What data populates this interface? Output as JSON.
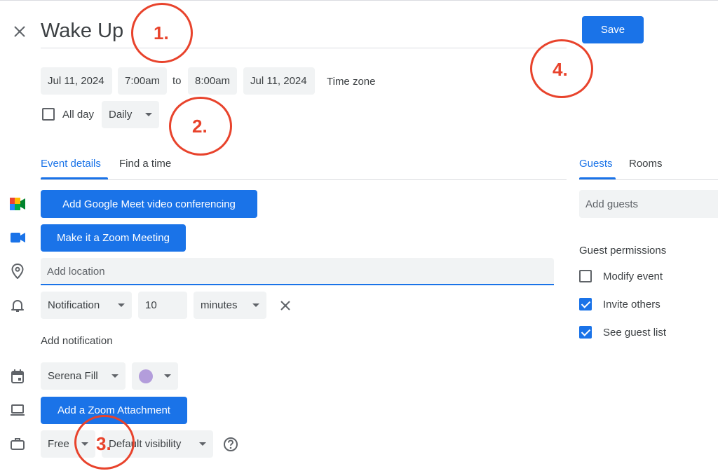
{
  "header": {
    "title": "Wake Up",
    "save_label": "Save"
  },
  "datetime": {
    "start_date": "Jul 11, 2024",
    "start_time": "7:00am",
    "to_label": "to",
    "end_time": "8:00am",
    "end_date": "Jul 11, 2024",
    "time_zone_label": "Time zone",
    "all_day_label": "All day",
    "recurrence": "Daily"
  },
  "tabs": {
    "event_details": "Event details",
    "find_a_time": "Find a time"
  },
  "details": {
    "meet_button": "Add Google Meet video conferencing",
    "zoom_button": "Make it a Zoom Meeting",
    "location_placeholder": "Add location",
    "notification_type": "Notification",
    "notification_value": "10",
    "notification_unit": "minutes",
    "add_notification": "Add notification",
    "calendar_owner": "Serena Fill",
    "calendar_color": "#b39ddb",
    "zoom_attachment_button": "Add a Zoom Attachment",
    "availability": "Free",
    "visibility": "Default visibility"
  },
  "guests_panel": {
    "tab_guests": "Guests",
    "tab_rooms": "Rooms",
    "add_guests_placeholder": "Add guests",
    "permissions_title": "Guest permissions",
    "permissions": [
      {
        "label": "Modify event",
        "checked": false
      },
      {
        "label": "Invite others",
        "checked": true
      },
      {
        "label": "See guest list",
        "checked": true
      }
    ]
  },
  "annotations": [
    "1.",
    "2.",
    "3.",
    "4."
  ],
  "colors": {
    "accent": "#1a73e8",
    "annotation": "#e8432c"
  }
}
